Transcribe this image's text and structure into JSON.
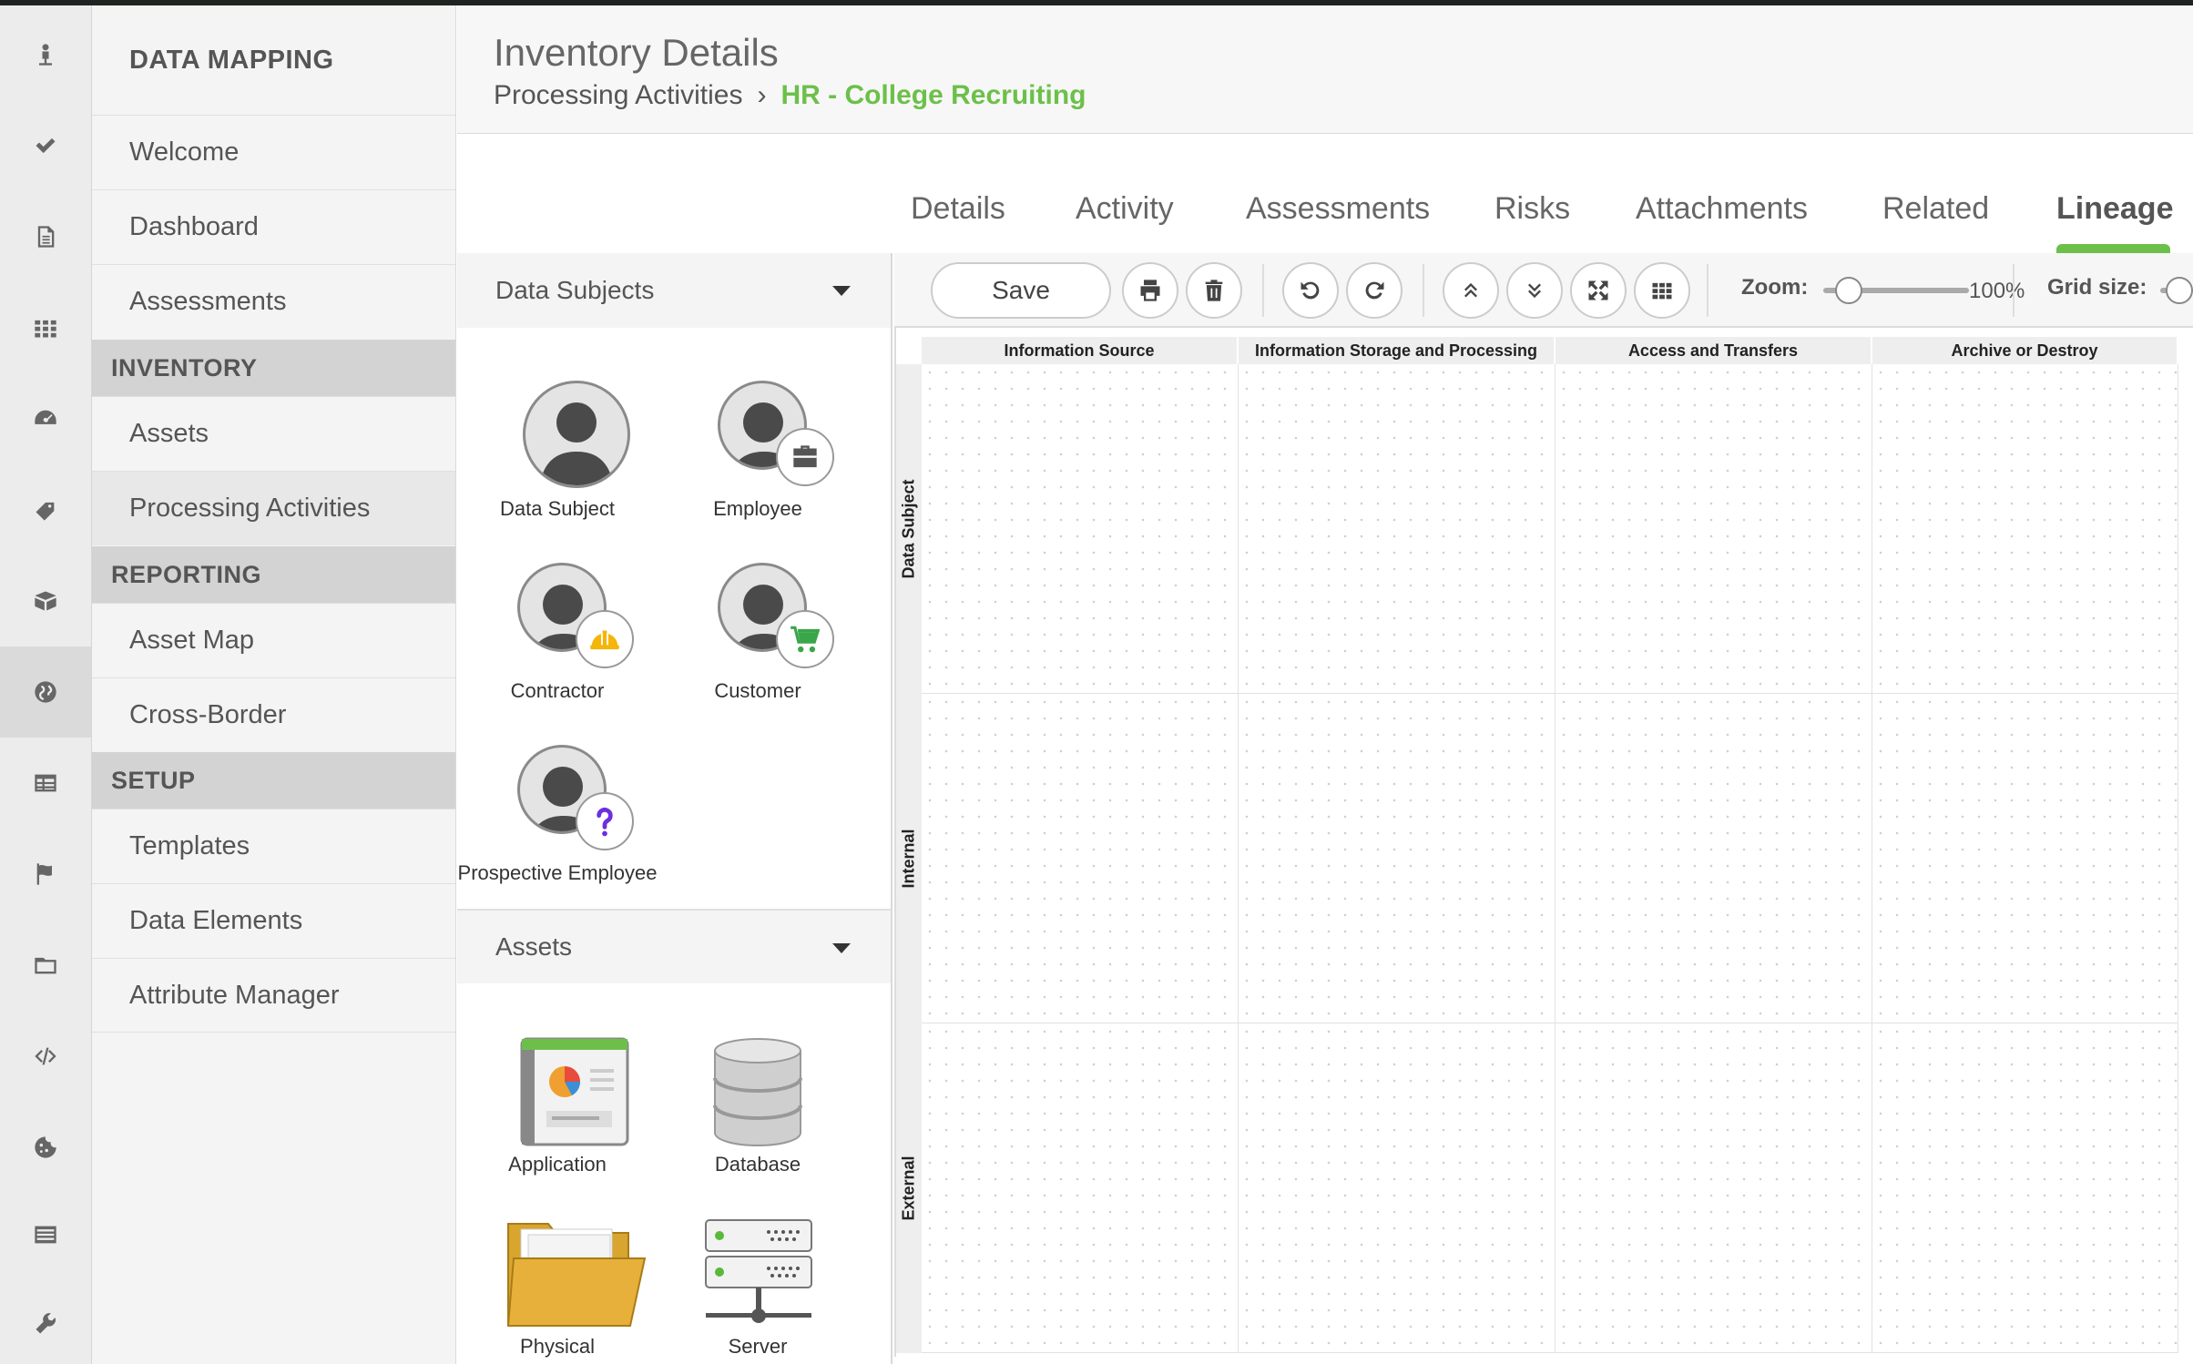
{
  "nav": {
    "title": "DATA MAPPING",
    "items": [
      {
        "label": "Welcome"
      },
      {
        "label": "Dashboard"
      },
      {
        "label": "Assessments"
      }
    ],
    "sections": [
      {
        "label": "INVENTORY",
        "items": [
          {
            "label": "Assets"
          },
          {
            "label": "Processing Activities"
          }
        ]
      },
      {
        "label": "REPORTING",
        "items": [
          {
            "label": "Asset Map"
          },
          {
            "label": "Cross-Border"
          }
        ]
      },
      {
        "label": "SETUP",
        "items": [
          {
            "label": "Templates"
          },
          {
            "label": "Data Elements"
          },
          {
            "label": "Attribute Manager"
          }
        ]
      }
    ]
  },
  "rail": [
    "user-icon",
    "check-icon",
    "document-icon",
    "grid-icon",
    "gauge-icon",
    "tag-icon",
    "box-icon",
    "globe-icon",
    "table-icon",
    "flag-icon",
    "folder-icon",
    "code-icon",
    "cookie-icon",
    "list-icon",
    "wrench-icon"
  ],
  "header": {
    "title": "Inventory Details",
    "breadcrumb_parent": "Processing Activities",
    "breadcrumb_sep": "›",
    "breadcrumb_current": "HR - College Recruiting"
  },
  "tabs": [
    "Details",
    "Activity",
    "Assessments",
    "Risks",
    "Attachments",
    "Related",
    "Lineage"
  ],
  "palette": {
    "data_subjects_header": "Data Subjects",
    "subjects": [
      "Data Subject",
      "Employee",
      "Contractor",
      "Customer",
      "Prospective Employee"
    ],
    "assets_header": "Assets",
    "assets": [
      "Application",
      "Database",
      "Physical",
      "Server"
    ]
  },
  "toolbar": {
    "save_label": "Save",
    "zoom_label": "Zoom:",
    "zoom_value": "100%",
    "zoom_level": 0.1,
    "grid_label": "Grid size:"
  },
  "lineage": {
    "columns": [
      "Information Source",
      "Information Storage and Processing",
      "Access and Transfers",
      "Archive or Destroy"
    ],
    "rows": [
      "Data Subject",
      "Internal",
      "External"
    ]
  },
  "colors": {
    "accent": "#6cc04a",
    "sidebar_bg": "#f4f4f4",
    "section_bg": "#d3d3d3"
  }
}
